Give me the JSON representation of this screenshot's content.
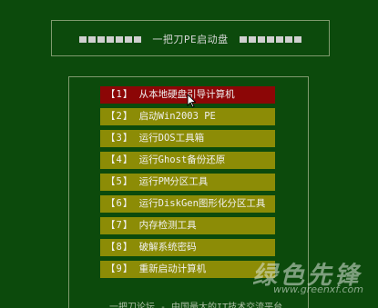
{
  "header": {
    "title": "一把刀PE启动盘"
  },
  "menu": {
    "items": [
      {
        "num": "【1】",
        "label": "从本地硬盘引导计算机",
        "selected": true
      },
      {
        "num": "【2】",
        "label": "启动Win2003 PE"
      },
      {
        "num": "【3】",
        "label": "运行DOS工具箱"
      },
      {
        "num": "【4】",
        "label": "运行Ghost备份还原"
      },
      {
        "num": "【5】",
        "label": "运行PM分区工具"
      },
      {
        "num": "【6】",
        "label": "运行DiskGen图形化分区工具"
      },
      {
        "num": "【7】",
        "label": "内存检测工具"
      },
      {
        "num": "【8】",
        "label": "破解系统密码"
      },
      {
        "num": "【9】",
        "label": "重新启动计算机"
      }
    ]
  },
  "footer": {
    "text": "一把刀论坛 - 中国最大的IT技术交流平台"
  },
  "watermark": {
    "name": "绿色先锋",
    "url": "www.greenxf.com"
  },
  "colors": {
    "background": "#0c4a0c",
    "menu_item": "#8c8c06",
    "menu_item_selected": "#8c0606",
    "border": "#7f9a6e"
  }
}
